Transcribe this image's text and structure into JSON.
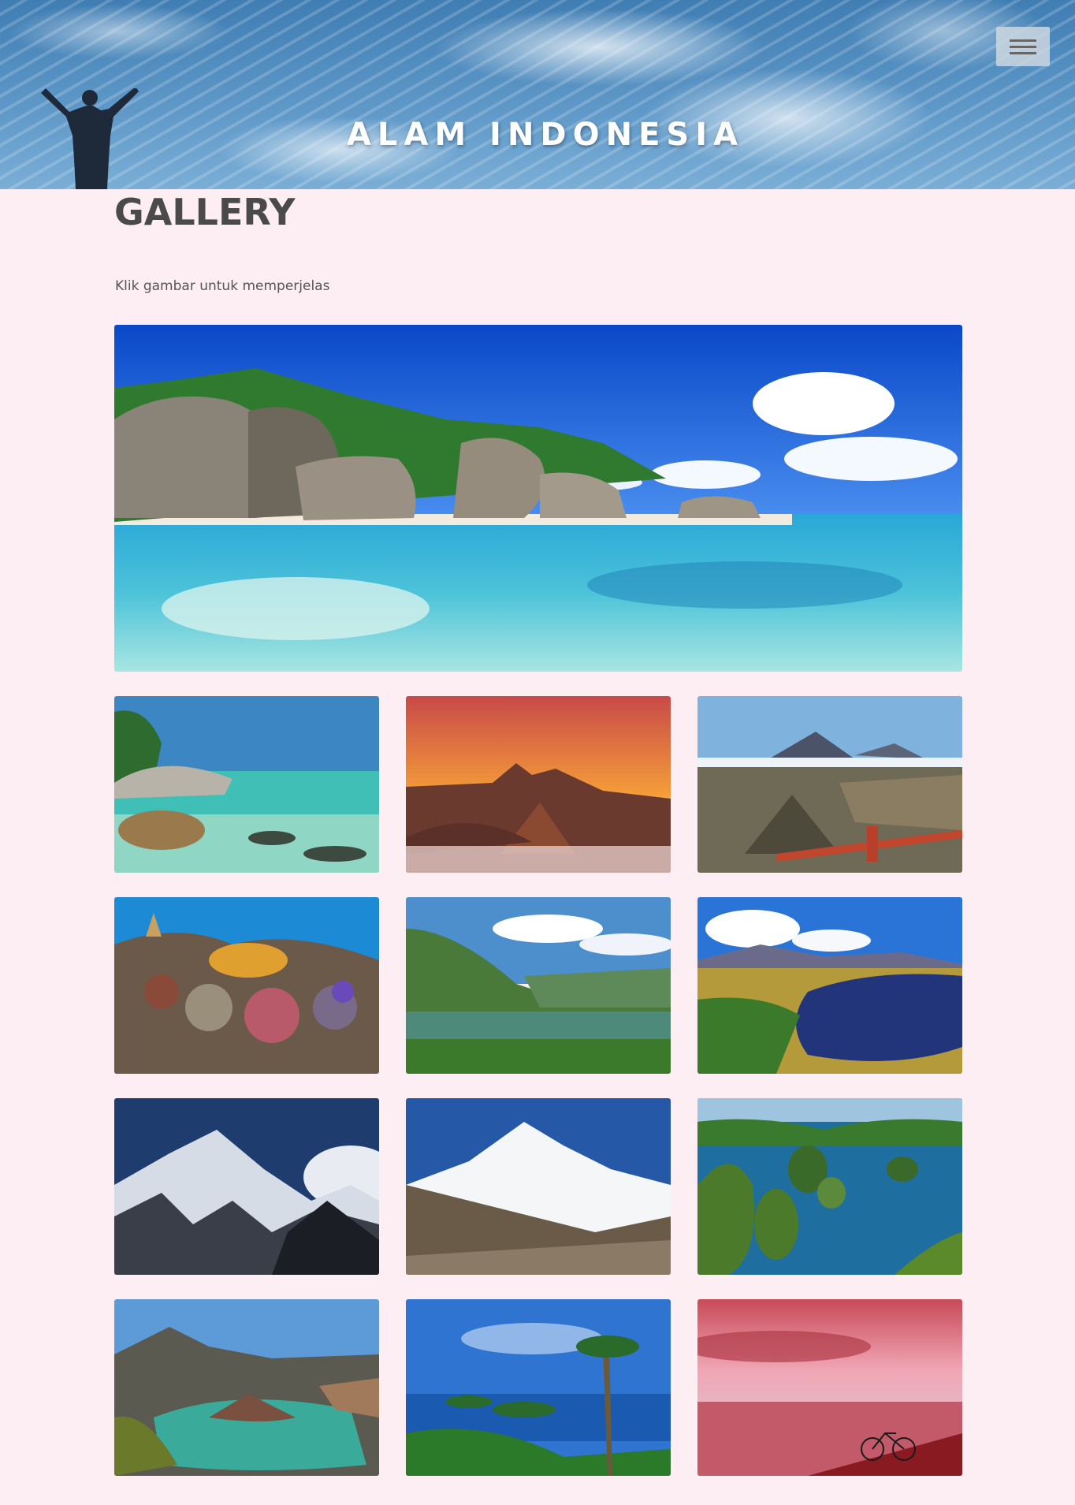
{
  "header": {
    "site_title": "ALAM INDONESIA",
    "menu_icon": "hamburger-icon"
  },
  "main": {
    "page_title": "GALLERY",
    "hint": "Klik gambar untuk memperjelas",
    "hero_image": "tropical-beach-boulders",
    "gallery": [
      "rocky-beach-turquoise-water",
      "bromo-sunrise",
      "bromo-caldera-view",
      "coral-reef",
      "green-valley-lake",
      "blue-lake-hills",
      "snowy-mountain-peaks",
      "snow-capped-mountain",
      "karst-islands",
      "volcano-crater-lake",
      "palm-island-bay",
      "pink-sunset-bicycle"
    ]
  }
}
